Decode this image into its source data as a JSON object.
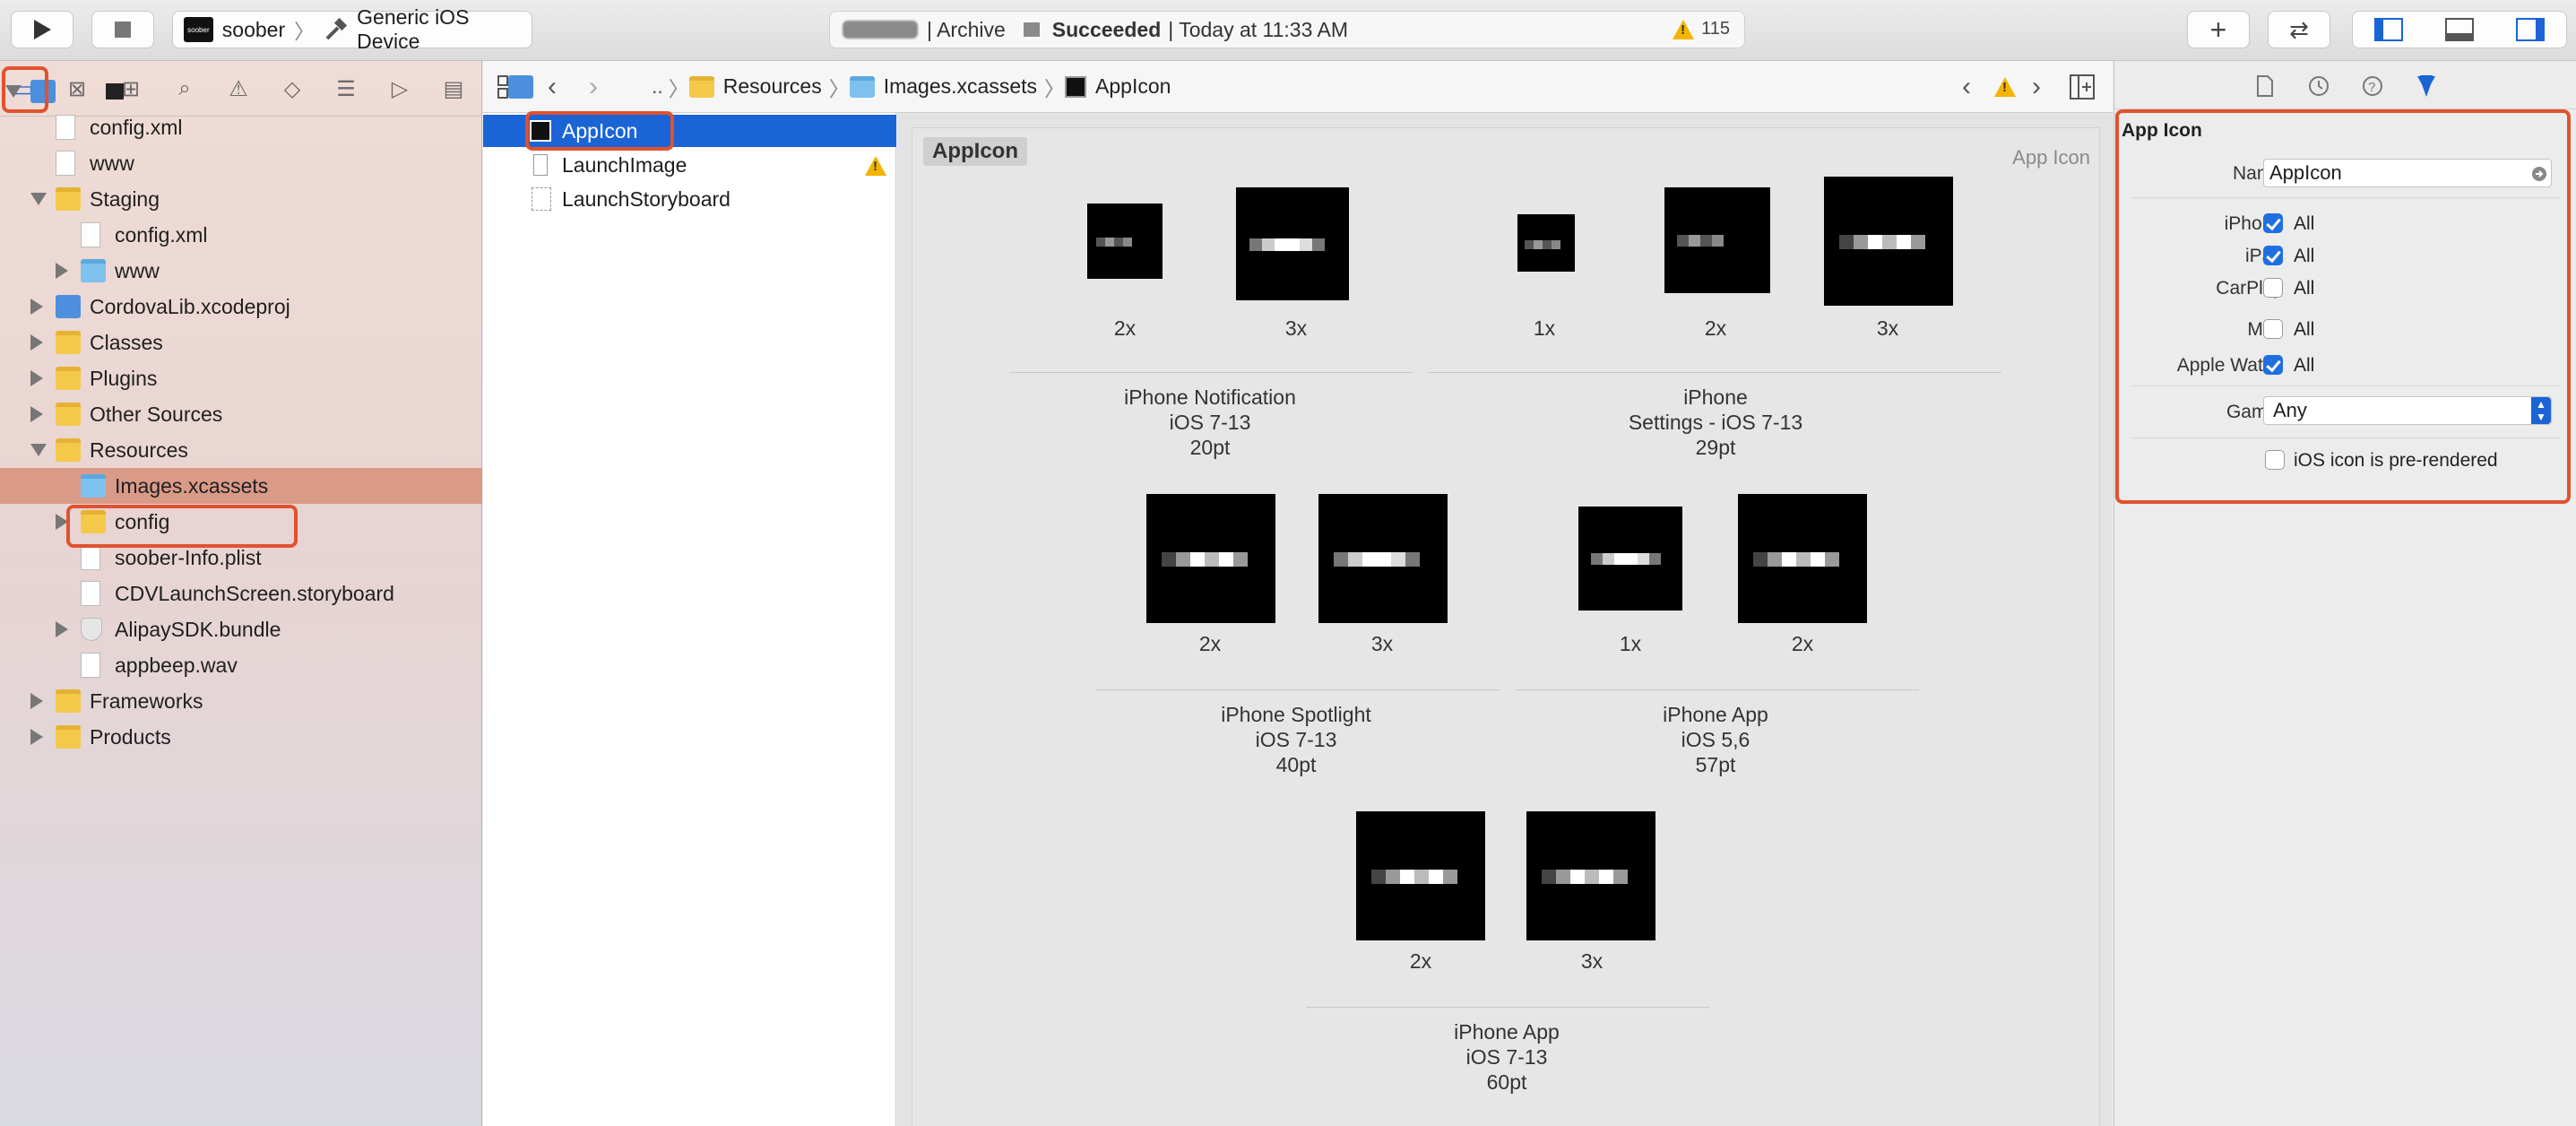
{
  "toolbar": {
    "scheme": {
      "logo_text": "soober",
      "project": "soober",
      "device": "Generic iOS Device"
    },
    "activity": {
      "prefix": "| Archive",
      "status": "Succeeded",
      "time": "| Today at 11:33 AM",
      "warnings": "115"
    },
    "icons": [
      "play-icon",
      "stop-icon",
      "plus-icon",
      "swap-icon",
      "left-panel-icon",
      "bottom-panel-icon",
      "right-panel-icon"
    ]
  },
  "navigator": {
    "tabs": [
      "folder-icon",
      "source-control-icon",
      "hierarchy-icon",
      "search-icon",
      "warning-icon",
      "test-icon",
      "debug-icon",
      "breakpoint-icon",
      "report-icon"
    ],
    "tree": [
      {
        "label": "",
        "depth": 0,
        "icon": "project",
        "disclosure": "open"
      },
      {
        "label": "config.xml",
        "depth": 1,
        "icon": "file-xml",
        "disclosure": ""
      },
      {
        "label": "www",
        "depth": 1,
        "icon": "file",
        "disclosure": ""
      },
      {
        "label": "Staging",
        "depth": 1,
        "icon": "folder-yellow",
        "disclosure": "open"
      },
      {
        "label": "config.xml",
        "depth": 2,
        "icon": "file-xml",
        "disclosure": ""
      },
      {
        "label": "www",
        "depth": 2,
        "icon": "folder-blue",
        "disclosure": "closed"
      },
      {
        "label": "CordovaLib.xcodeproj",
        "depth": 1,
        "icon": "project",
        "disclosure": "closed"
      },
      {
        "label": "Classes",
        "depth": 1,
        "icon": "folder-yellow",
        "disclosure": "closed"
      },
      {
        "label": "Plugins",
        "depth": 1,
        "icon": "folder-yellow",
        "disclosure": "closed"
      },
      {
        "label": "Other Sources",
        "depth": 1,
        "icon": "folder-yellow",
        "disclosure": "closed"
      },
      {
        "label": "Resources",
        "depth": 1,
        "icon": "folder-yellow",
        "disclosure": "open"
      },
      {
        "label": "Images.xcassets",
        "depth": 2,
        "icon": "folder-blue",
        "disclosure": "",
        "selected": true
      },
      {
        "label": "config",
        "depth": 2,
        "icon": "folder-yellow",
        "disclosure": "closed"
      },
      {
        "label": "soober-Info.plist",
        "depth": 2,
        "icon": "file-plist",
        "disclosure": ""
      },
      {
        "label": "CDVLaunchScreen.storyboard",
        "depth": 2,
        "icon": "file-storyboard",
        "disclosure": ""
      },
      {
        "label": "AlipaySDK.bundle",
        "depth": 2,
        "icon": "bundle",
        "disclosure": "closed"
      },
      {
        "label": "appbeep.wav",
        "depth": 2,
        "icon": "file-audio",
        "disclosure": ""
      },
      {
        "label": "Frameworks",
        "depth": 1,
        "icon": "folder-yellow",
        "disclosure": "closed"
      },
      {
        "label": "Products",
        "depth": 1,
        "icon": "folder-yellow",
        "disclosure": "closed"
      }
    ]
  },
  "jumpbar": {
    "ellipsis": "..",
    "crumbs": [
      "Resources",
      "Images.xcassets",
      "AppIcon"
    ]
  },
  "assets": [
    {
      "label": "AppIcon",
      "selected": true,
      "warning": false
    },
    {
      "label": "LaunchImage",
      "selected": false,
      "warning": true
    },
    {
      "label": "LaunchStoryboard",
      "selected": false,
      "warning": false
    }
  ],
  "canvas": {
    "title": "AppIcon",
    "type": "App Icon",
    "groups": [
      {
        "lines": [
          "iPhone Notification",
          "iOS 7-13",
          "20pt"
        ],
        "scales": [
          "2x",
          "3x"
        ]
      },
      {
        "lines": [
          "iPhone",
          "Settings - iOS 7-13",
          "29pt"
        ],
        "scales": [
          "1x",
          "2x",
          "3x"
        ]
      },
      {
        "lines": [
          "iPhone Spotlight",
          "iOS 7-13",
          "40pt"
        ],
        "scales": [
          "2x",
          "3x"
        ]
      },
      {
        "lines": [
          "iPhone App",
          "iOS 5,6",
          "57pt"
        ],
        "scales": [
          "1x",
          "2x"
        ]
      },
      {
        "lines": [
          "iPhone App",
          "iOS 7-13",
          "60pt"
        ],
        "scales": [
          "2x",
          "3x"
        ]
      }
    ]
  },
  "inspector": {
    "tabs": [
      "file-icon",
      "history-icon",
      "help-icon",
      "attributes-icon"
    ],
    "section": "App Icon",
    "name_label": "Name",
    "name_value": "AppIcon",
    "devices": [
      {
        "label": "iPhone",
        "value": "All",
        "checked": true
      },
      {
        "label": "iPad",
        "value": "All",
        "checked": true
      },
      {
        "label": "CarPlay",
        "value": "All",
        "checked": false
      },
      {
        "label": "Mac",
        "value": "All",
        "checked": false
      },
      {
        "label": "Apple Watch",
        "value": "All",
        "checked": true
      }
    ],
    "gamut_label": "Gamut",
    "gamut_value": "Any",
    "prerendered_label": "iOS icon is pre-rendered",
    "prerendered_checked": false
  },
  "colors": {
    "accent": "#1a64d6",
    "highlight": "#e0522e",
    "warning": "#f5b400"
  }
}
